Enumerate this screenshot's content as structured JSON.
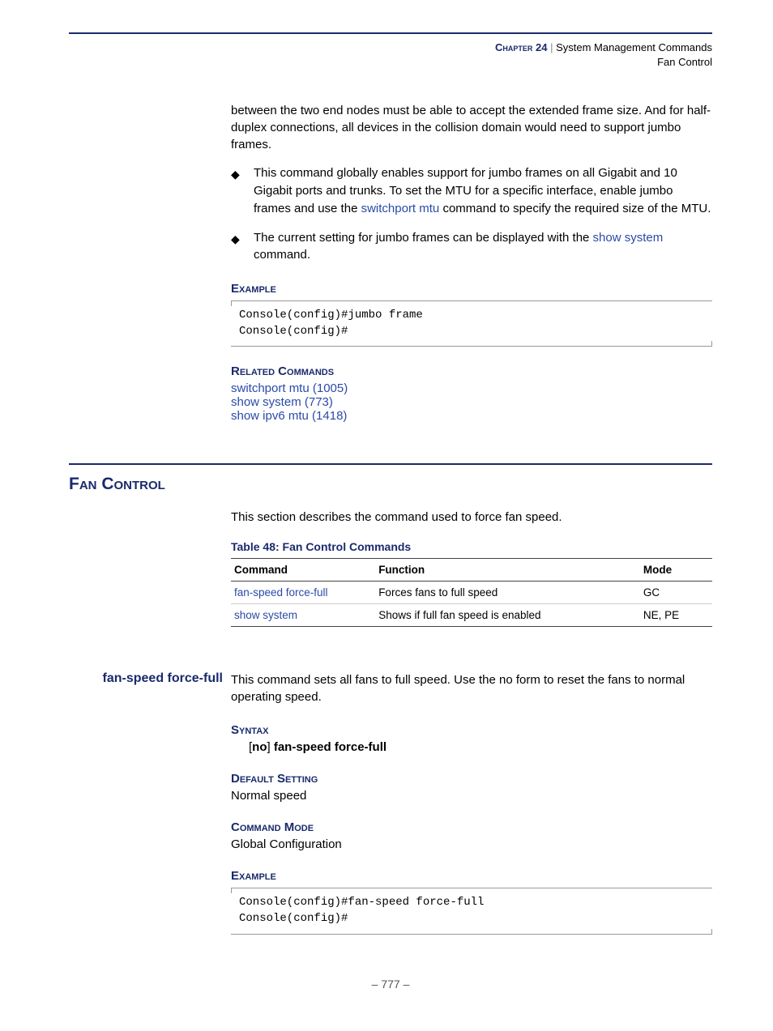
{
  "header": {
    "chapter_label": "Chapter 24",
    "separator": "  |  ",
    "chapter_title": "System Management Commands",
    "subtitle": "Fan Control"
  },
  "intro_para": "between the two end nodes must be able to accept the extended frame size. And for half-duplex connections, all devices in the collision domain would need to support jumbo frames.",
  "bullets": {
    "b1_pre": "This command globally enables support for jumbo frames on all Gigabit and 10 Gigabit ports and trunks. To set the MTU for a specific interface, enable jumbo frames and use the ",
    "b1_link": "switchport mtu",
    "b1_post": " command to specify the required size of the MTU.",
    "b2_pre": "The current setting for jumbo frames can be displayed with the ",
    "b2_link": "show system",
    "b2_post": " command."
  },
  "labels": {
    "example": "Example",
    "related_commands": "Related Commands",
    "syntax": "Syntax",
    "default_setting": "Default Setting",
    "command_mode": "Command Mode"
  },
  "example1_code": "Console(config)#jumbo frame\nConsole(config)#",
  "related_commands": {
    "r1": "switchport mtu (1005)",
    "r2": "show system (773)",
    "r3": "show ipv6 mtu (1418)"
  },
  "section": {
    "title": "Fan Control",
    "intro": "This section describes the command used to force fan speed."
  },
  "table": {
    "caption": "Table 48: Fan Control Commands",
    "headers": {
      "c1": "Command",
      "c2": "Function",
      "c3": "Mode"
    },
    "rows": [
      {
        "cmd": "fan-speed force-full",
        "func": "Forces fans to full speed",
        "mode": "GC"
      },
      {
        "cmd": "show system",
        "func": "Shows if full fan speed is enabled",
        "mode": "NE, PE"
      }
    ]
  },
  "command": {
    "name": "fan-speed force-full",
    "desc": "This command sets all fans to full speed. Use the no form to reset the fans to normal operating speed.",
    "syntax_no": "no",
    "syntax_cmd": "fan-speed force-full",
    "default_val": "Normal speed",
    "mode_val": "Global Configuration",
    "example_code": "Console(config)#fan-speed force-full\nConsole(config)#"
  },
  "footer": {
    "page": "–  777  –"
  }
}
